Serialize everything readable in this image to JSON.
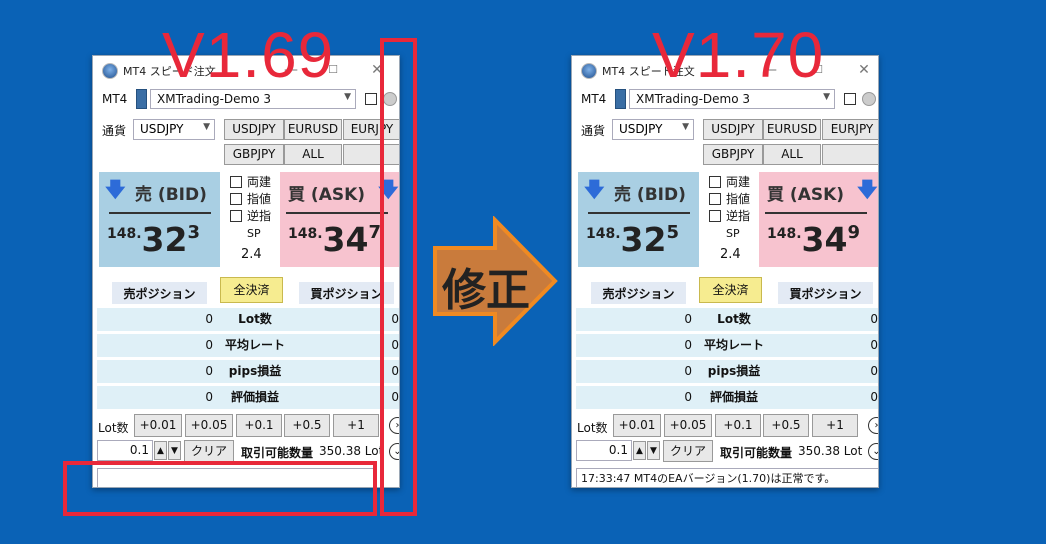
{
  "annotations": {
    "old_version": "V1.69",
    "new_version": "V1.70",
    "fix_label": "修正"
  },
  "windows": [
    {
      "id": "old",
      "title": "MT4 スピード注文",
      "mt4_label": "MT4",
      "broker": "XMTrading-Demo 3",
      "currency_label": "通貨",
      "selected_pair": "USDJPY",
      "pair_buttons": [
        "USDJPY",
        "EURUSD",
        "EURJPY",
        "GBPJPY",
        "ALL",
        ""
      ],
      "bid": {
        "label": "売 (BID)",
        "big": "148.",
        "main": "32",
        "small": "3"
      },
      "ask": {
        "label": "買 (ASK)",
        "big": "148.",
        "main": "34",
        "small": "7"
      },
      "checks": [
        "両建",
        "指値",
        "逆指"
      ],
      "sp_label": "SP",
      "sp_value": "2.4",
      "sell_position_tab": "売ポジション",
      "close_all": "全決済",
      "buy_position_tab": "買ポジション",
      "stats": [
        {
          "left": "0",
          "label": "Lot数",
          "right": "0"
        },
        {
          "left": "0",
          "label": "平均レート",
          "right": "0"
        },
        {
          "left": "0",
          "label": "pips損益",
          "right": "0"
        },
        {
          "left": "0",
          "label": "評価損益",
          "right": "0"
        }
      ],
      "lot_label": "Lot数",
      "lot_buttons": [
        "+0.01",
        "+0.05",
        "+0.1",
        "+0.5",
        "+1"
      ],
      "lot_value": "0.1",
      "clear": "クリア",
      "available_label": "取引可能数量",
      "available_value": "350.38 Lot",
      "status": ""
    },
    {
      "id": "new",
      "title": "MT4 スピード注文",
      "mt4_label": "MT4",
      "broker": "XMTrading-Demo 3",
      "currency_label": "通貨",
      "selected_pair": "USDJPY",
      "pair_buttons": [
        "USDJPY",
        "EURUSD",
        "EURJPY",
        "GBPJPY",
        "ALL",
        ""
      ],
      "bid": {
        "label": "売 (BID)",
        "big": "148.",
        "main": "32",
        "small": "5"
      },
      "ask": {
        "label": "買 (ASK)",
        "big": "148.",
        "main": "34",
        "small": "9"
      },
      "checks": [
        "両建",
        "指値",
        "逆指"
      ],
      "sp_label": "SP",
      "sp_value": "2.4",
      "sell_position_tab": "売ポジション",
      "close_all": "全決済",
      "buy_position_tab": "買ポジション",
      "stats": [
        {
          "left": "0",
          "label": "Lot数",
          "right": "0"
        },
        {
          "left": "0",
          "label": "平均レート",
          "right": "0"
        },
        {
          "left": "0",
          "label": "pips損益",
          "right": "0"
        },
        {
          "left": "0",
          "label": "評価損益",
          "right": "0"
        }
      ],
      "lot_label": "Lot数",
      "lot_buttons": [
        "+0.01",
        "+0.05",
        "+0.1",
        "+0.5",
        "+1"
      ],
      "lot_value": "0.1",
      "clear": "クリア",
      "available_label": "取引可能数量",
      "available_value": "350.38 Lot",
      "status": "17:33:47 MT4のEAバージョン(1.70)は正常です。"
    }
  ]
}
